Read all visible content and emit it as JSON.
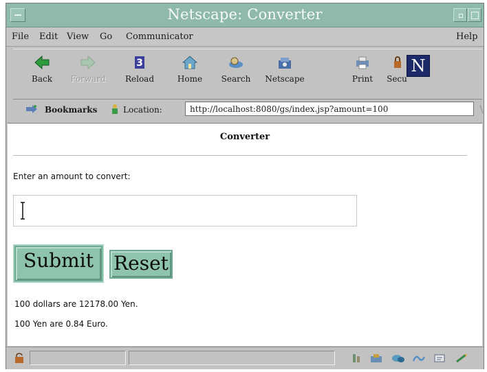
{
  "window": {
    "title": "Netscape: Converter"
  },
  "menubar": {
    "items": [
      "File",
      "Edit",
      "View",
      "Go",
      "Communicator"
    ],
    "help": "Help"
  },
  "toolbar": {
    "buttons": [
      {
        "label": "Back",
        "icon": "back-arrow-icon",
        "enabled": true
      },
      {
        "label": "Forward",
        "icon": "forward-arrow-icon",
        "enabled": false
      },
      {
        "label": "Reload",
        "icon": "reload-icon",
        "enabled": true
      },
      {
        "label": "Home",
        "icon": "home-icon",
        "enabled": true
      },
      {
        "label": "Search",
        "icon": "search-icon",
        "enabled": true
      },
      {
        "label": "Netscape",
        "icon": "netscape-icon",
        "enabled": true
      },
      {
        "label": "Print",
        "icon": "print-icon",
        "enabled": true
      },
      {
        "label": "Secu",
        "icon": "security-icon",
        "enabled": true
      }
    ],
    "logo": "N"
  },
  "locationbar": {
    "bookmarks_label": "Bookmarks",
    "location_label": "Location:",
    "url": "http://localhost:8080/gs/index.jsp?amount=100"
  },
  "page": {
    "title": "Converter",
    "prompt": "Enter an amount to convert:",
    "amount_value": "",
    "submit_label": "Submit",
    "reset_label": "Reset",
    "results": [
      "100 dollars are 12178.00 Yen.",
      "100 Yen are 0.84 Euro."
    ]
  },
  "colors": {
    "titlebar": "#8fb9ac",
    "button": "#8ec3ac",
    "chrome": "#c2c2c2"
  }
}
